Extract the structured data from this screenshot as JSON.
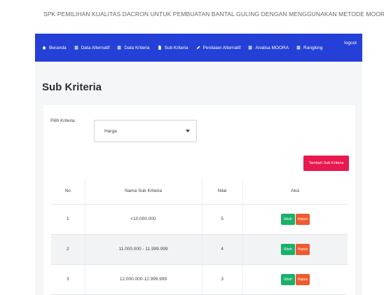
{
  "app": {
    "title": "SPK PEMILIHAN KUALITAS DACRON UNTUK PEMBUATAN BANTAL GULING DENGAN MENGGUNAKAN METODE MOORA"
  },
  "nav": {
    "items": [
      {
        "label": "Beranda",
        "icon": "home-icon"
      },
      {
        "label": "Data Alternatif",
        "icon": "list-icon"
      },
      {
        "label": "Data Kriteria",
        "icon": "list-icon"
      },
      {
        "label": "Sub Kriteria",
        "icon": "file-icon"
      },
      {
        "label": "Penilaian Alternatif",
        "icon": "edit-icon"
      },
      {
        "label": "Analisa MOORA",
        "icon": "list-icon"
      },
      {
        "label": "Rangking",
        "icon": "list-icon"
      }
    ],
    "logout_label": "logout",
    "color": "#2440d6"
  },
  "page": {
    "title": "Sub Kriteria"
  },
  "filter": {
    "label": "Pilih Kriteria",
    "selected": "Harga"
  },
  "add_button": {
    "label": "Tambah Sub Kriteria",
    "color": "#e8194f"
  },
  "table": {
    "headers": [
      "No",
      "Nama Sub Kriteria",
      "Nilai",
      "Aksi"
    ],
    "rows": [
      {
        "no": "1",
        "nama": "<10.000.000",
        "nilai": "5"
      },
      {
        "no": "2",
        "nama": "11.000.000 - 11.999.999",
        "nilai": "4"
      },
      {
        "no": "3",
        "nama": "12.000.000-12.999.999",
        "nilai": "3"
      }
    ],
    "edit_label": "Ubah",
    "delete_label": "Hapus"
  }
}
